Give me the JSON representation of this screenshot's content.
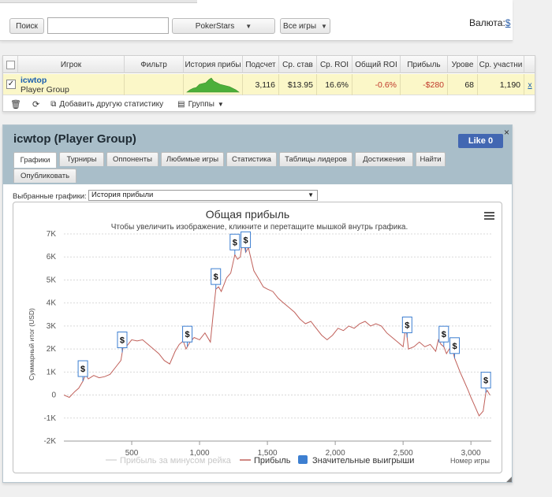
{
  "toolbar": {
    "search_button": "Поиск",
    "search_value": "",
    "site_select": "PokerStars",
    "games_select": "Все игры",
    "currency_label": "Валюта:",
    "currency_value": "$"
  },
  "table": {
    "columns": [
      "Игрок",
      "Фильтр",
      "История прибы",
      "Подсчет",
      "Ср. став",
      "Ср. ROI",
      "Общий ROI",
      "Прибыль",
      "Урове",
      "Ср. участни"
    ],
    "row": {
      "checked": "✓",
      "player_name": "icwtop",
      "player_group": "Player Group",
      "filter": "",
      "count": "3,116",
      "avg_stake": "$13.95",
      "avg_roi": "16.6%",
      "total_roi": "-0.6%",
      "profit": "-$280",
      "level": "68",
      "avg_entrants": "1,190",
      "remove": "x"
    },
    "footer": {
      "add_stat": "Добавить другую статистику",
      "groups": "Группы"
    }
  },
  "graph_panel": {
    "title": "icwtop (Player Group)",
    "like_label": "Like 0",
    "close": "×",
    "tabs": [
      "Графики",
      "Турниры",
      "Оппоненты",
      "Любимые игры",
      "Статистика",
      "Таблицы лидеров",
      "Достижения",
      "Найти",
      "Опубликовать"
    ],
    "active_tab": "Графики",
    "selected_graphs_label": "Выбранные графики:",
    "selected_graph": "История прибыли"
  },
  "chart_data": {
    "type": "line",
    "title": "Общая прибыль",
    "subtitle": "Чтобы увеличить изображение, кликните и перетащите мышкой внутрь графика.",
    "xlabel": "Номер игры",
    "ylabel": "Суммарный итог (USD)",
    "xlim": [
      0,
      3150
    ],
    "ylim": [
      -2000,
      7000
    ],
    "x_ticks": [
      "500",
      "1,000",
      "1,500",
      "2,000",
      "2,500",
      "3,000"
    ],
    "x_tick_values": [
      500,
      1000,
      1500,
      2000,
      2500,
      3000
    ],
    "y_ticks": [
      "7K",
      "6K",
      "5K",
      "4K",
      "3K",
      "2K",
      "1K",
      "0",
      "-1K",
      "-2K"
    ],
    "y_tick_values": [
      7000,
      6000,
      5000,
      4000,
      3000,
      2000,
      1000,
      0,
      -1000,
      -2000
    ],
    "grid": true,
    "legend_position": "bottom",
    "series": [
      {
        "name": "Прибыль за минусом рейка",
        "color": "#d8d8d8",
        "visible": false,
        "x": [],
        "y": []
      },
      {
        "name": "Прибыль",
        "color": "#c0605a",
        "visible": true,
        "x": [
          0,
          40,
          80,
          110,
          140,
          160,
          180,
          220,
          260,
          300,
          340,
          380,
          420,
          440,
          460,
          500,
          540,
          580,
          620,
          660,
          700,
          740,
          780,
          820,
          850,
          880,
          900,
          930,
          960,
          1000,
          1040,
          1080,
          1100,
          1120,
          1140,
          1160,
          1200,
          1230,
          1260,
          1280,
          1300,
          1320,
          1340,
          1360,
          1380,
          1400,
          1430,
          1470,
          1500,
          1540,
          1580,
          1620,
          1660,
          1700,
          1740,
          1780,
          1820,
          1860,
          1900,
          1940,
          1980,
          2020,
          2060,
          2100,
          2140,
          2180,
          2220,
          2260,
          2300,
          2340,
          2380,
          2420,
          2460,
          2500,
          2520,
          2540,
          2580,
          2620,
          2660,
          2700,
          2740,
          2760,
          2780,
          2800,
          2820,
          2840,
          2860,
          2880,
          2900,
          2920,
          2950,
          2980,
          3000,
          3030,
          3060,
          3090,
          3110,
          3120,
          3140
        ],
        "y": [
          0,
          -100,
          150,
          300,
          600,
          900,
          700,
          850,
          750,
          800,
          900,
          1200,
          1500,
          2200,
          2100,
          2400,
          2350,
          2400,
          2200,
          2000,
          1800,
          1500,
          1350,
          1900,
          2200,
          2350,
          2000,
          2300,
          2500,
          2400,
          2700,
          2300,
          3500,
          4600,
          4700,
          4500,
          5100,
          5300,
          6100,
          5900,
          6000,
          6800,
          6200,
          6400,
          5900,
          5400,
          5100,
          4700,
          4600,
          4500,
          4200,
          4000,
          3800,
          3600,
          3300,
          3100,
          3200,
          2900,
          2600,
          2400,
          2600,
          2900,
          2800,
          3000,
          2900,
          3100,
          3200,
          3000,
          3100,
          3000,
          2700,
          2500,
          2300,
          2100,
          3000,
          2000,
          2100,
          2300,
          2100,
          2200,
          1900,
          2400,
          2200,
          2100,
          1800,
          2000,
          2100,
          1600,
          1300,
          1000,
          600,
          200,
          -100,
          -500,
          -900,
          -700,
          100,
          200,
          0
        ]
      },
      {
        "name": "Значительные выигрыши",
        "color": "#3d7fd1",
        "visible": true,
        "x": [],
        "y": []
      }
    ],
    "markers": {
      "label": "$",
      "x": [
        140,
        430,
        910,
        1120,
        1260,
        1340,
        2530,
        2800,
        2880,
        3110
      ]
    }
  }
}
